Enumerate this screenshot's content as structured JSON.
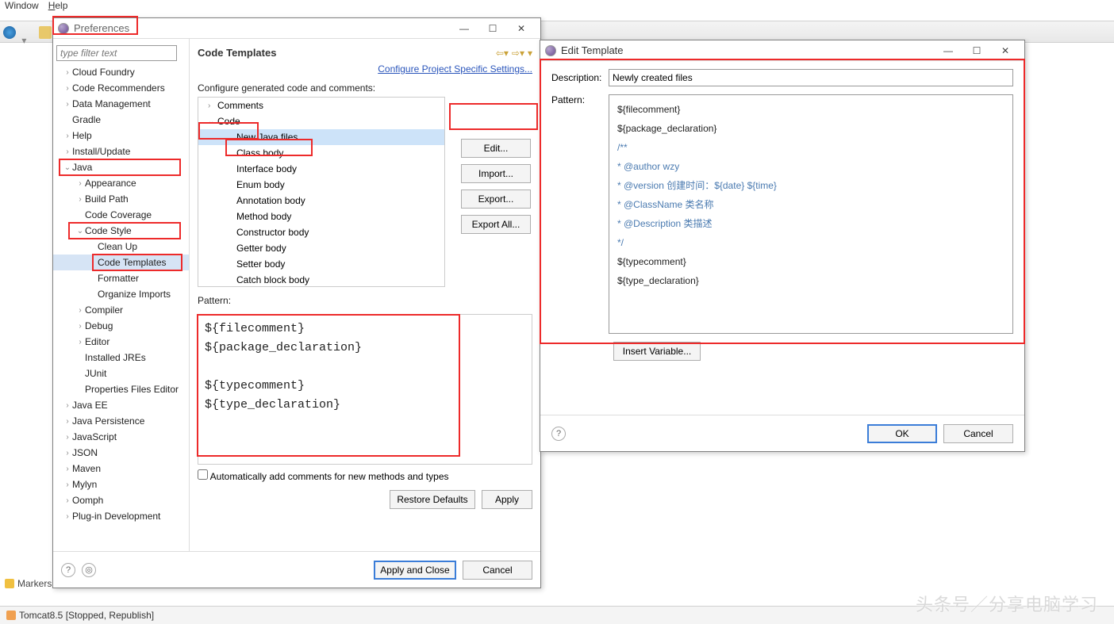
{
  "menubar": {
    "window": "Window",
    "help": "Help"
  },
  "pref": {
    "title": "Preferences",
    "filter_placeholder": "type filter text",
    "tree": [
      {
        "l": 1,
        "a": ">",
        "t": "Cloud Foundry"
      },
      {
        "l": 1,
        "a": ">",
        "t": "Code Recommenders"
      },
      {
        "l": 1,
        "a": ">",
        "t": "Data Management"
      },
      {
        "l": 1,
        "a": "",
        "t": "Gradle"
      },
      {
        "l": 1,
        "a": ">",
        "t": "Help"
      },
      {
        "l": 1,
        "a": ">",
        "t": "Install/Update"
      },
      {
        "l": 1,
        "a": "v",
        "t": "Java",
        "hl": 1
      },
      {
        "l": 2,
        "a": ">",
        "t": "Appearance"
      },
      {
        "l": 2,
        "a": ">",
        "t": "Build Path"
      },
      {
        "l": 2,
        "a": "",
        "t": "Code Coverage"
      },
      {
        "l": 2,
        "a": "v",
        "t": "Code Style",
        "hl": 1
      },
      {
        "l": 3,
        "a": "",
        "t": "Clean Up"
      },
      {
        "l": 3,
        "a": "",
        "t": "Code Templates",
        "sel": 1,
        "hl": 1
      },
      {
        "l": 3,
        "a": "",
        "t": "Formatter"
      },
      {
        "l": 3,
        "a": "",
        "t": "Organize Imports"
      },
      {
        "l": 2,
        "a": ">",
        "t": "Compiler"
      },
      {
        "l": 2,
        "a": ">",
        "t": "Debug"
      },
      {
        "l": 2,
        "a": ">",
        "t": "Editor"
      },
      {
        "l": 2,
        "a": "",
        "t": "Installed JREs"
      },
      {
        "l": 2,
        "a": "",
        "t": "JUnit"
      },
      {
        "l": 2,
        "a": "",
        "t": "Properties Files Editor"
      },
      {
        "l": 1,
        "a": ">",
        "t": "Java EE"
      },
      {
        "l": 1,
        "a": ">",
        "t": "Java Persistence"
      },
      {
        "l": 1,
        "a": ">",
        "t": "JavaScript"
      },
      {
        "l": 1,
        "a": ">",
        "t": "JSON"
      },
      {
        "l": 1,
        "a": ">",
        "t": "Maven"
      },
      {
        "l": 1,
        "a": ">",
        "t": "Mylyn"
      },
      {
        "l": 1,
        "a": ">",
        "t": "Oomph"
      },
      {
        "l": 1,
        "a": ">",
        "t": "Plug-in Development"
      }
    ],
    "heading": "Code Templates",
    "link": "Configure Project Specific Settings...",
    "configure_label": "Configure generated code and comments:",
    "code_tree": [
      {
        "a": ">",
        "t": "Comments",
        "ind": 0
      },
      {
        "a": "v",
        "t": "Code",
        "ind": 0,
        "hl": 1
      },
      {
        "a": "",
        "t": "New Java files",
        "ind": 1,
        "sel": 1,
        "hl": 1
      },
      {
        "a": "",
        "t": "Class body",
        "ind": 1
      },
      {
        "a": "",
        "t": "Interface body",
        "ind": 1
      },
      {
        "a": "",
        "t": "Enum body",
        "ind": 1
      },
      {
        "a": "",
        "t": "Annotation body",
        "ind": 1
      },
      {
        "a": "",
        "t": "Method body",
        "ind": 1
      },
      {
        "a": "",
        "t": "Constructor body",
        "ind": 1
      },
      {
        "a": "",
        "t": "Getter body",
        "ind": 1
      },
      {
        "a": "",
        "t": "Setter body",
        "ind": 1
      },
      {
        "a": "",
        "t": "Catch block body",
        "ind": 1
      }
    ],
    "buttons": {
      "edit": "Edit...",
      "import": "Import...",
      "export": "Export...",
      "export_all": "Export All..."
    },
    "pattern_label": "Pattern:",
    "pattern_lines": [
      "${filecomment}",
      "${package_declaration}",
      "",
      "${typecomment}",
      "${type_declaration}"
    ],
    "auto_comments": "Automatically add comments for new methods and types",
    "restore": "Restore Defaults",
    "apply": "Apply",
    "apply_close": "Apply and Close",
    "cancel": "Cancel"
  },
  "edit": {
    "title": "Edit Template",
    "desc_label": "Description:",
    "desc_value": "Newly created files",
    "pattern_label": "Pattern:",
    "code_plain_1": "${filecomment}\n${package_declaration}",
    "code_comment": "/**\n* @author wzy\n* @version 创建时间：${date} ${time}\n* @ClassName 类名称\n* @Description 类描述\n*/",
    "code_plain_2": "${typecomment}\n${type_declaration}",
    "insert_var": "Insert Variable...",
    "ok": "OK",
    "cancel": "Cancel"
  },
  "status": {
    "markers": "Markers",
    "tomcat": "Tomcat8.5  [Stopped, Republish]"
  },
  "watermark": "头条号／分享电脑学习"
}
